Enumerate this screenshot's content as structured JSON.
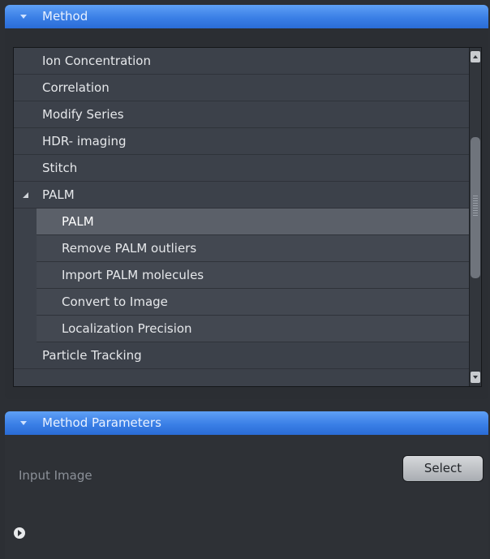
{
  "method_panel": {
    "title": "Method",
    "items": [
      {
        "label": "Ion Concentration"
      },
      {
        "label": "Correlation"
      },
      {
        "label": "Modify Series"
      },
      {
        "label": "HDR- imaging"
      },
      {
        "label": "Stitch"
      },
      {
        "label": "PALM",
        "expanded": true,
        "children": [
          {
            "label": "PALM",
            "selected": true
          },
          {
            "label": "Remove PALM outliers"
          },
          {
            "label": "Import PALM molecules"
          },
          {
            "label": "Convert to Image"
          },
          {
            "label": "Localization Precision"
          }
        ]
      },
      {
        "label": "Particle Tracking"
      }
    ]
  },
  "params_panel": {
    "title": "Method Parameters",
    "input_label": "Input Image",
    "select_label": "Select"
  },
  "icons": {
    "collapse": "chevron-down-icon",
    "expander": "triangle-expanded-icon",
    "info": "info-play-icon"
  },
  "colors": {
    "header_blue": "#3a7fe6",
    "panel_bg": "#2c2f34",
    "list_bg": "#3c414a",
    "selected_row": "#5b6069"
  }
}
